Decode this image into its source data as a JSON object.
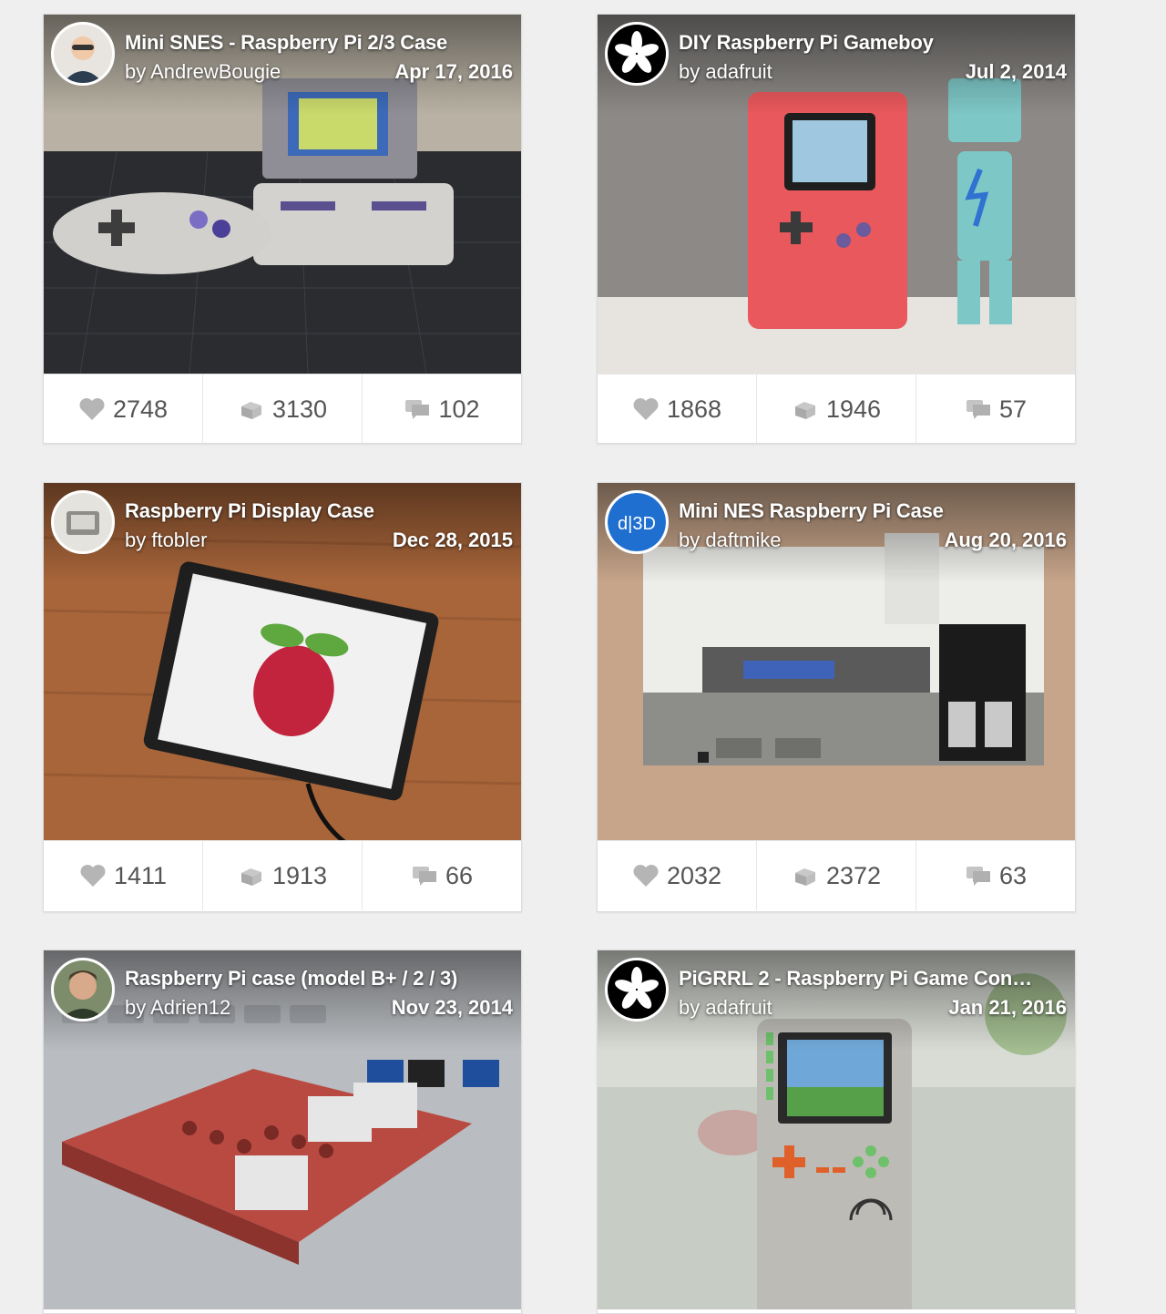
{
  "cards": [
    {
      "title": "Mini SNES - Raspberry Pi 2/3 Case",
      "author": "by AndrewBougie",
      "date": "Apr 17, 2016",
      "likes": "2748",
      "collects": "3130",
      "comments": "102"
    },
    {
      "title": "DIY Raspberry Pi Gameboy",
      "author": "by adafruit",
      "date": "Jul 2, 2014",
      "likes": "1868",
      "collects": "1946",
      "comments": "57"
    },
    {
      "title": "Raspberry Pi Display Case",
      "author": "by ftobler",
      "date": "Dec 28, 2015",
      "likes": "1411",
      "collects": "1913",
      "comments": "66"
    },
    {
      "title": "Mini NES Raspberry Pi Case",
      "author": "by daftmike",
      "date": "Aug 20, 2016",
      "avatar_text": "d|3D",
      "likes": "2032",
      "collects": "2372",
      "comments": "63"
    },
    {
      "title": "Raspberry Pi case (model B+ / 2 / 3)",
      "author": "by Adrien12",
      "date": "Nov 23, 2014"
    },
    {
      "title": "PiGRRL 2 - Raspberry Pi Game Con…",
      "author": "by adafruit",
      "date": "Jan 21, 2016"
    }
  ],
  "icons": {
    "like": "heart-icon",
    "collect": "collection-icon",
    "comment": "comment-icon"
  },
  "colors": {
    "page_bg": "#efefef",
    "stat_icon": "#b5b5b5",
    "stat_text": "#555555",
    "avatar_d3d": "#1f6fd1"
  }
}
